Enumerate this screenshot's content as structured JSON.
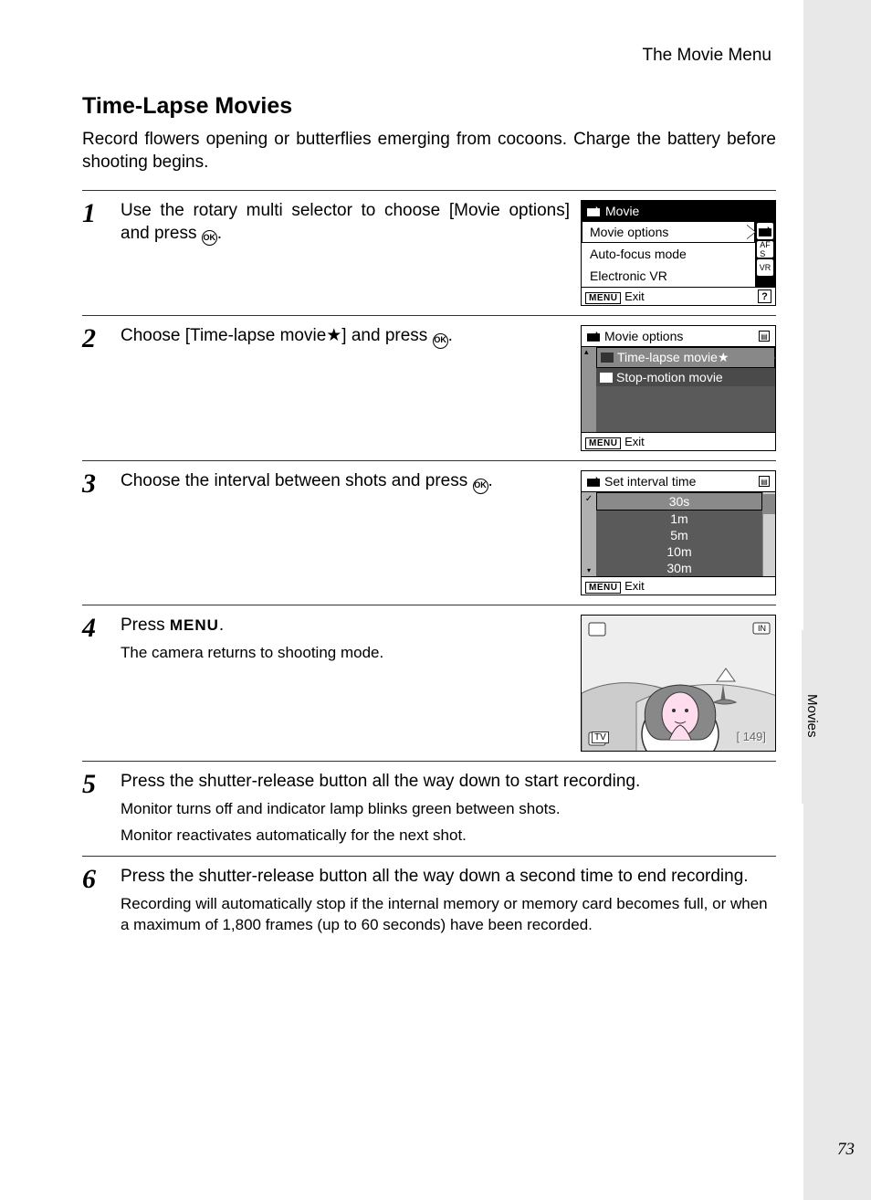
{
  "chapter": "The Movie Menu",
  "side_tab": "Movies",
  "title": "Time-Lapse Movies",
  "intro": "Record flowers opening or butterflies emerging from cocoons. Charge the battery before shooting begins.",
  "page_number": "73",
  "steps": {
    "s1": {
      "num": "1",
      "text_a": "Use the rotary multi selector to choose [Movie options] and press ",
      "text_b": "."
    },
    "s2": {
      "num": "2",
      "text_a": "Choose [Time-lapse movie★] and press ",
      "text_b": "."
    },
    "s3": {
      "num": "3",
      "text_a": "Choose the interval between shots and press ",
      "text_b": "."
    },
    "s4": {
      "num": "4",
      "text_a": "Press ",
      "menu_word": "MENU",
      "text_b": ".",
      "sub": "The camera returns to shooting mode."
    },
    "s5": {
      "num": "5",
      "text": "Press the shutter-release button all the way down to start recording.",
      "sub1": "Monitor turns off and indicator lamp blinks green between shots.",
      "sub2": "Monitor reactivates automatically for the next shot."
    },
    "s6": {
      "num": "6",
      "text": "Press the shutter-release button all the way down a second time to end recording.",
      "sub": "Recording will automatically stop if the internal memory or memory card becomes full, or when a maximum of 1,800 frames (up to 60 seconds) have been recorded."
    }
  },
  "screens": {
    "sc1": {
      "title": "Movie",
      "items": [
        "Movie options",
        "Auto-focus mode",
        "Electronic VR"
      ],
      "exit": "Exit",
      "menu": "MENU",
      "help": "?"
    },
    "sc2": {
      "title": "Movie options",
      "items": [
        "Time-lapse movie★",
        "Stop-motion movie"
      ],
      "exit": "Exit",
      "menu": "MENU"
    },
    "sc3": {
      "title": "Set interval time",
      "items": [
        "30s",
        "1m",
        "5m",
        "10m",
        "30m"
      ],
      "exit": "Exit",
      "menu": "MENU"
    },
    "sc4": {
      "counter": "[  149]",
      "tv": "TV",
      "in": "IN"
    }
  },
  "icons": {
    "ok": "OK"
  }
}
